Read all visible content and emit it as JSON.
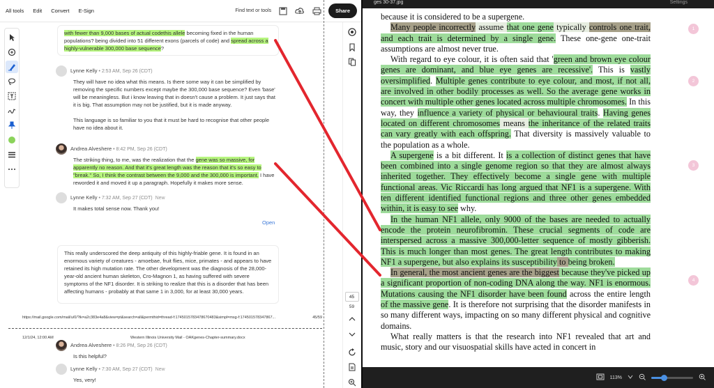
{
  "toolbar": {
    "menus": [
      "All tools",
      "Edit",
      "Convert",
      "E-Sign"
    ],
    "find_text": "Find text or tools",
    "share_label": "Share"
  },
  "comments": {
    "top_card": {
      "hl1": "with fewer than 9,000 bases of actual codethis allele",
      "t1": " becoming fixed in the human populations? being divided into 51 different exons (parcels of code) and ",
      "hl2": "spread across a highly-vulnerable 300,000 base sequence",
      "t2": "?"
    },
    "c1": {
      "author": "Lynne Kelly",
      "time": " • 2:53 AM, Sep 26 (CDT)",
      "p1": "They will have no idea what this means. Is there some way it can be simplified by removing the specific numbers except maybe the 300,000 base sequence? Even 'base' will be meaningless. But i know leaving that in doesn't cause a problem. It just says that it is big. That assumption may not be justified, but it is made anyway.",
      "p2": "This language is so familiar to you that it must be hard to recognise that other people have no idea about it."
    },
    "c2": {
      "author": "Andrea Alveshere",
      "time": " • 8:42 PM, Sep 26 (CDT)",
      "t1": "The striking thing, to me, was the realization that the ",
      "hl1": "gene was so massive, for apparently no reason.  And that it's great length was the reason that it's so easy to \"break.\"  So, I think the contrast between the 9,000 and the 300,000 is important.",
      "t2": "  I have reworded it and moved it up a paragraph.  Hopefully it makes more sense."
    },
    "c3": {
      "author": "Lynne Kelly",
      "time": " • 7:32 AM, Sep 27 (CDT)",
      "now": "New",
      "text": "It makes total sense now. Thank you!"
    },
    "open_label": "Open",
    "second_card": "This really underscored the deep antiquity of this highly-friable gene. It is found in an enormous variety of creatures - amoebae, fruit flies, mice, primates - and appears to have retained its high mutation rate. The other development was the diagnosis of the 28,000-year-old ancient human skeleton, Cro-Magnon 1, as having suffered with severe symptoms of the NF1 disorder. It is striking to realize that this is a disorder that has been affecting humans - probably at that same 1 in 3,000, for at least 30,000 years.",
    "url_text": "https://mail.google.com/mail/u/0/?ik=a2c383e4a8&view=pt&search=all&permthid=thread-f:1745015783478670483&simpl=msg-f:174501578347867...",
    "url_page": "45/59",
    "footer_date": "12/1/24, 12:00 AM",
    "footer_title": "Western Illinois University Mail - OAKgenes-Chapter-summary.docx",
    "c4": {
      "author": "Andrea Alveshere",
      "time": " • 8:26 PM, Sep 26 (CDT)",
      "text": "Is this helpful?"
    },
    "c5": {
      "author": "Lynne Kelly",
      "time": " • 7:30 AM, Sep 27 (CDT)",
      "now": "New",
      "text": "Yes, very!"
    }
  },
  "right_rail": {
    "page_current": "45",
    "page_total": "59"
  },
  "viewer": {
    "top_title": "ges 30-37.jpg",
    "settings": "Settings",
    "zoom": "113%",
    "markers": [
      "1",
      "2",
      "3",
      "4"
    ],
    "line0": "because it is considered to be a supergene.",
    "p1": {
      "a": "Many people incorrectly",
      "b": " assume ",
      "c": "that one gene",
      "d": " typically ",
      "e": "controls one trait,",
      "f": " and each trait is determined by a single gene.",
      "g": " These one-gene one-trait assumptions are almost never true."
    },
    "p2": {
      "a": "With regard to eye colour, it is often said that '",
      "b": "green and brown eye colour genes are dominant, and blue eye genes are recessive'.",
      "c": " This is ",
      "d": "vastly oversimplified",
      "e": ". ",
      "f": "Multiple genes contribute to eye colour, and most, if not all, are involved in other bodily processes as well. So the average gene works in concert with multiple other genes located across multiple chromosomes.",
      "g": " In this way, they ",
      "h": "influence a variety of physical or behavioural traits",
      "i": ". ",
      "j": "Having genes located on different chromosomes",
      "k": " means ",
      "l": "the inheritance of the related traits can vary greatly with each offspring.",
      "m": " That diversity is massively valuable to the population as a whole."
    },
    "p3": {
      "a": "A supergene",
      "b": " is a bit different. It ",
      "c": "is a collection of distinct genes that have been combined into a single genome region",
      "d": " so that they are almost always inherited together. They effectively become a single gene with multiple functional areas.",
      "e": " Vic Riccardi has long argued that NF1 is a supergene. With ten different identified functional regions and three other genes embedded within, it is easy to see",
      "f": " why."
    },
    "p4": {
      "a": "In the human NF1 allele, only 9000 of the bases are needed to actually encode the protein neurofibromin.",
      "b": " These crucial segments of code are interspersed across a massive 300,000-letter sequence of mostly gibberish.",
      "c": " This is much longer than most genes. The great length contributes to making NF1 a supergene, but also explains its susceptibility",
      "d": " to ",
      "e": "being broken."
    },
    "p5": {
      "a": "In general, the most ancient genes are the biggest",
      "b": " because they've picked up a significant proportion of non-coding DNA along the way. NF1 is enormous. Mutations causing the NF1 disorder have been found",
      "c": " across the entire length ",
      "d": "of the massive gene",
      "e": ". It is therefore not surprising that the disorder manifests in so many different ways, impacting on so many different physical and cognitive domains."
    },
    "p6": "What really matters is that the research into NF1 revealed that art and music, story and our visuospatial skills have acted in concert in"
  },
  "colors": {
    "highlight_green": "#b6f57e",
    "text_green": "#9edb9b",
    "arrow_red": "#e3262e",
    "accent_blue": "#3b78d8"
  }
}
